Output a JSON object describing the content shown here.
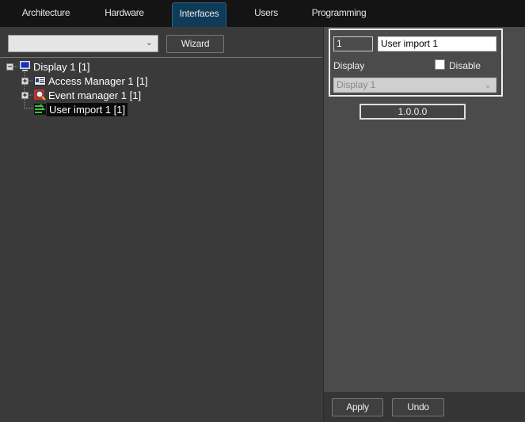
{
  "tabs": [
    {
      "label": "Architecture"
    },
    {
      "label": "Hardware"
    },
    {
      "label": "Interfaces"
    },
    {
      "label": "Users"
    },
    {
      "label": "Programming"
    }
  ],
  "toolbar": {
    "combo_value": "",
    "wizard_label": "Wizard"
  },
  "tree": [
    {
      "label": "Display 1 [1]",
      "icon": "monitor-icon"
    },
    {
      "label": "Access Manager 1 [1]",
      "icon": "id-card-icon"
    },
    {
      "label": "Event manager 1 [1]",
      "icon": "magnifier-icon"
    },
    {
      "label": "User import 1 [1]",
      "icon": "import-arrows-icon"
    }
  ],
  "props": {
    "id": "1",
    "name": "User import 1",
    "display_label": "Display",
    "disable_label": "Disable",
    "display_value": "Display 1",
    "version": "1.0.0.0"
  },
  "footer": {
    "apply": "Apply",
    "undo": "Undo"
  }
}
